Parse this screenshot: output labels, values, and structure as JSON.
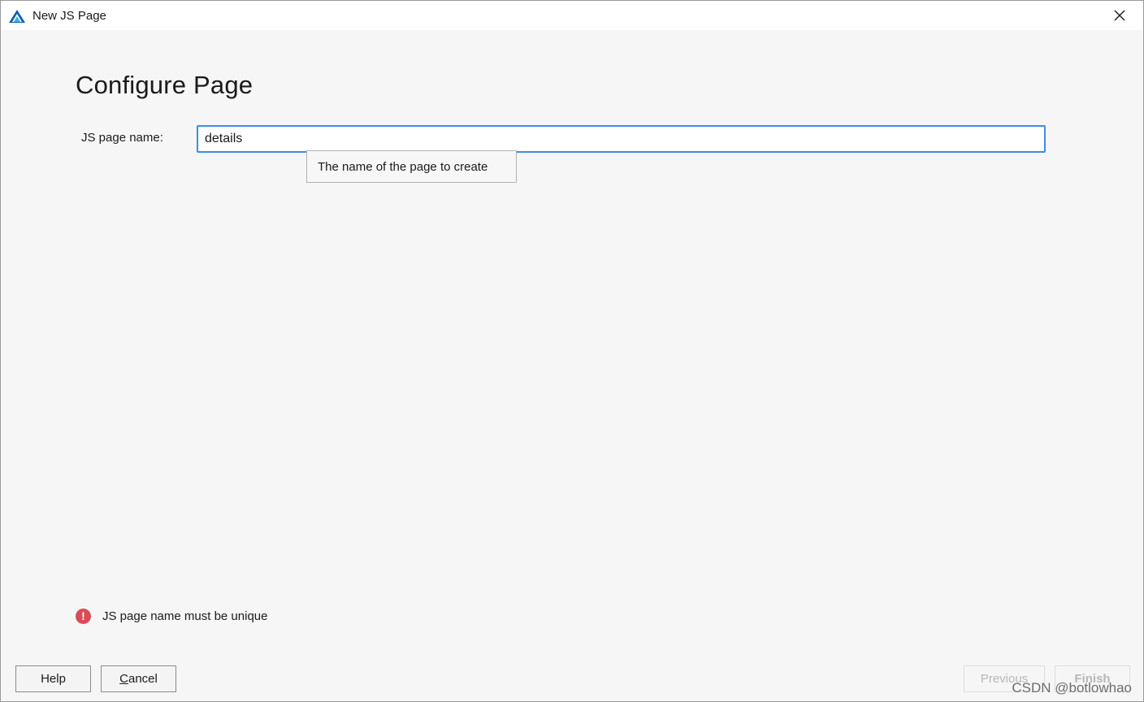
{
  "window": {
    "title": "New JS Page",
    "close_label": "×"
  },
  "page": {
    "title": "Configure Page"
  },
  "form": {
    "name_label": "JS page name:",
    "name_value": "details",
    "tooltip": "The name of the page to create"
  },
  "validation": {
    "error_icon": "!",
    "message": "JS page name must be unique"
  },
  "buttons": {
    "help": "Help",
    "cancel_mnemonic": "C",
    "cancel_rest": "ancel",
    "previous": "Previous",
    "finish": "Finish"
  },
  "watermark": "CSDN @botlowhao",
  "colors": {
    "focus_border": "#3d8de6",
    "error": "#d94c57",
    "app_icon_dark": "#0b5fb3",
    "app_icon_light": "#2fb3e8"
  }
}
